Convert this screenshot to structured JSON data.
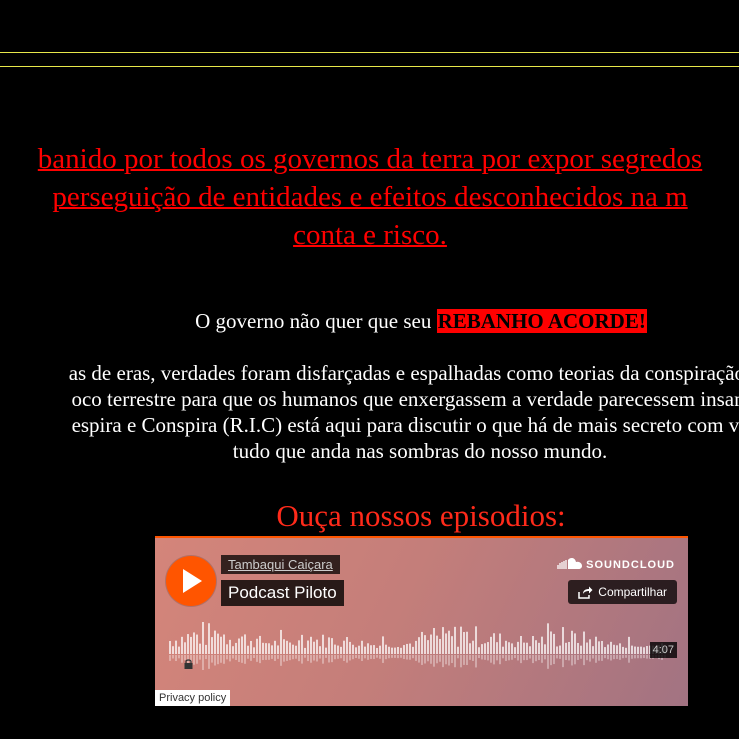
{
  "warning": {
    "line1": "banido por todos os governos da terra por expor segredos",
    "line2": "perseguição de entidades e efeitos desconhecidos na m",
    "line3": "conta e risco."
  },
  "government": {
    "prefix": "O governo não quer que seu",
    "highlight": "REBANHO ACORDE!",
    "highlight_color": "#ff0000"
  },
  "intro": {
    "line1": "as de eras, verdades foram disfarçadas e espalhadas como teorias da conspiração po",
    "line2": "oco terrestre para que os humanos que enxergassem a verdade parecessem insanos,",
    "line3": "espira e Conspira (R.I.C) está aqui para discutir o que há de mais secreto com você",
    "line4": "tudo que anda nas sombras do nosso mundo."
  },
  "listen_heading": "Ouça nossos episodios:",
  "player": {
    "artist": "Tambaqui Caiçara",
    "track": "Podcast Piloto",
    "brand": "SOUNDCLOUD",
    "share_label": "Compartilhar",
    "duration": "4:07",
    "privacy": "Privacy policy",
    "accent": "#ff5500",
    "progress": 0
  },
  "colors": {
    "warning": "#ff0000",
    "rule": "#e8e84a",
    "background": "#000000"
  }
}
